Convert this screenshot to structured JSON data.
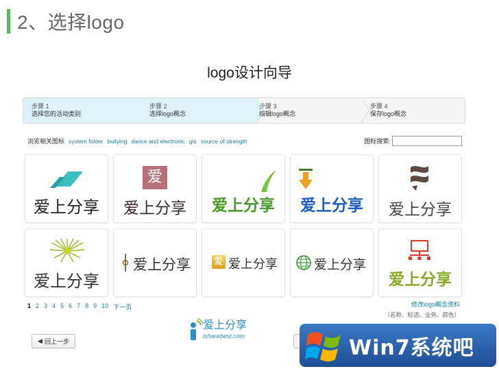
{
  "section": {
    "title": "2、选择logo"
  },
  "wizard": {
    "title": "logo设计向导"
  },
  "steps": [
    {
      "num": "步骤 1",
      "label": "选择您的活动类别"
    },
    {
      "num": "步骤 2",
      "label": "选择logo概念"
    },
    {
      "num": "步骤 3",
      "label": "编辑logo概念"
    },
    {
      "num": "步骤 4",
      "label": "保存logo概念"
    }
  ],
  "browse": {
    "label": "浏览相关图标",
    "tags": [
      "system folder",
      "bullying",
      "dance and electronic",
      "gis",
      "source of strength"
    ]
  },
  "search": {
    "label": "图标搜索:",
    "value": ""
  },
  "logos": {
    "text": "爱上分享",
    "badge": "爱"
  },
  "pager": {
    "pages": [
      "1",
      "2",
      "3",
      "4",
      "5",
      "6",
      "7",
      "8",
      "9",
      "10"
    ],
    "current": "1",
    "next": "下一页"
  },
  "modify": {
    "link": "修改logo概念资料",
    "sub": "（名称、标语、业务、颜色）"
  },
  "prev_button": {
    "label": "回上一步"
  },
  "brand": {
    "name": "爱上分享",
    "url": "isharebest.com"
  },
  "watermark": {
    "text": "Win7系统吧"
  },
  "colors": {
    "accent_green": "#5cb85c",
    "step_active": "#dff1fb",
    "link": "#1a7a9a"
  }
}
